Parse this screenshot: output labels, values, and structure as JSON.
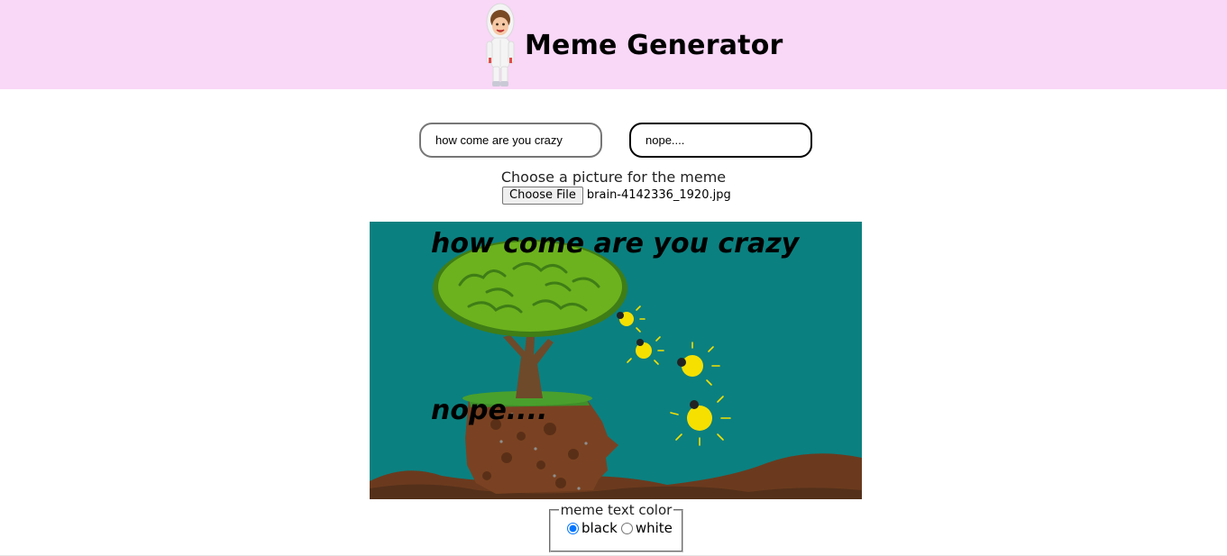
{
  "header": {
    "title": "Meme Generator",
    "background_color": "#f9d7f7",
    "logo_icon": "cartoon-boy-icon"
  },
  "inputs": {
    "top_text": {
      "value": "how come are you crazy"
    },
    "bottom_text": {
      "value": "nope...."
    }
  },
  "file_picker": {
    "label": "Choose a picture for the meme",
    "button_label": "Choose File",
    "selected_file": "brain-4142336_1920.jpg"
  },
  "meme": {
    "top_text": "how come are you crazy",
    "bottom_text": "nope....",
    "text_color": "#000000",
    "image_subject": "tree-growing-from-head-with-lightbulbs"
  },
  "text_color_picker": {
    "legend": "meme text color",
    "options": [
      {
        "label": "black",
        "checked": true
      },
      {
        "label": "white",
        "checked": false
      }
    ]
  }
}
